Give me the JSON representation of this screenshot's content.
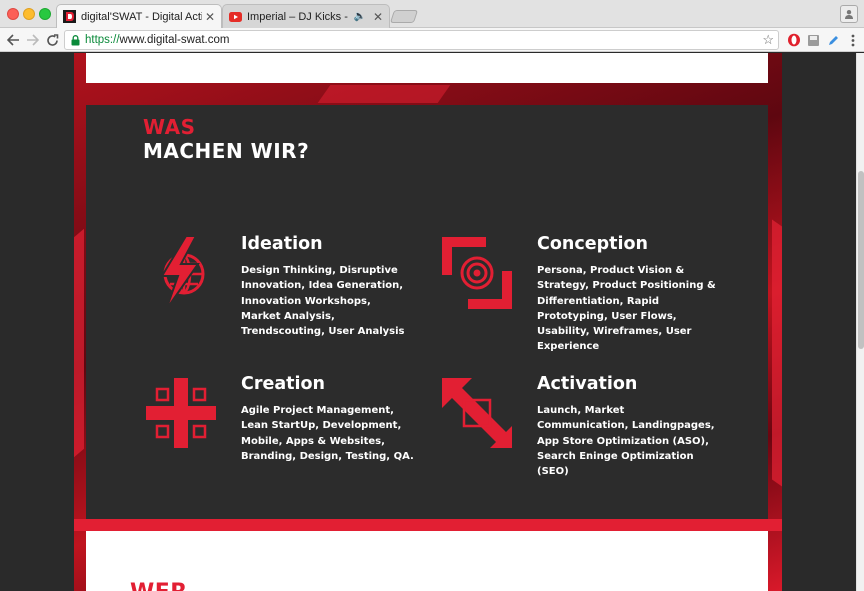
{
  "browser": {
    "tabs": [
      {
        "title": "digital'SWAT - Digital Activation",
        "favicon": "digitalswat-logo-icon",
        "active": true
      },
      {
        "title": "Imperial – DJ Kicks - YouTube",
        "favicon": "youtube-icon",
        "active": false,
        "audio": true
      }
    ],
    "url": {
      "scheme": "https://",
      "rest": "www.digital-swat.com"
    }
  },
  "page": {
    "heading_small": "WAS",
    "heading_big": "MACHEN WIR?",
    "services": [
      {
        "title": "Ideation",
        "icon": "lightning-globe-icon",
        "description": "Design Thinking, Disruptive Innovation, Idea Generation, Innovation Workshops, Market Analysis, Trendscouting, User Analysis"
      },
      {
        "title": "Conception",
        "icon": "target-frame-icon",
        "description": "Persona, Product Vision & Strategy, Product Positioning & Differentiation, Rapid Prototyping, User Flows, Usability, Wireframes, User Experience"
      },
      {
        "title": "Creation",
        "icon": "cross-grid-icon",
        "description": "Agile Project Management, Lean StartUp, Development, Mobile, Apps & Websites, Branding, Design, Testing, QA."
      },
      {
        "title": "Activation",
        "icon": "diagonal-expand-icon",
        "description": "Launch, Market Communication, Landingpages, App Store Optimization (ASO), Search Eninge Optimization (SEO)"
      }
    ],
    "next_section_heading": "WER"
  },
  "colors": {
    "accent": "#e21f33",
    "dark_card": "#2c2c2c",
    "background": "#2a2a2a"
  }
}
